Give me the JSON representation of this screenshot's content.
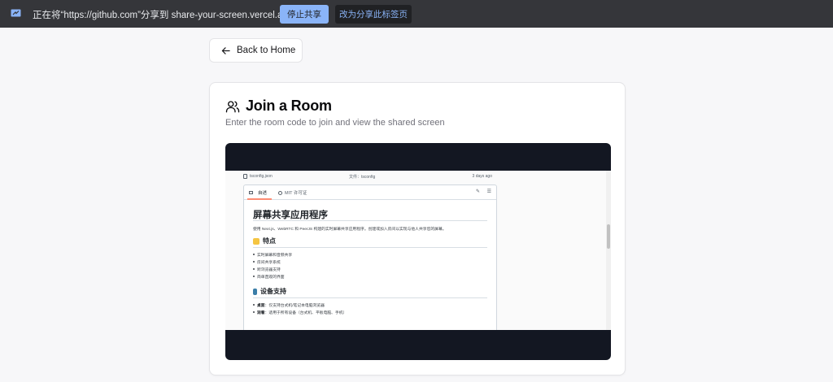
{
  "share_bar": {
    "message": "正在将“https://github.com”分享到 share-your-screen.vercel.app",
    "stop_label": "停止共享",
    "switch_label": "改为分享此标签页"
  },
  "back_button": {
    "label": "Back to Home",
    "icon": "arrow-left-icon"
  },
  "card": {
    "icon": "users-icon",
    "title": "Join a Room",
    "subtitle": "Enter the room code to join and view the shared screen"
  },
  "shared_screen": {
    "file_header": {
      "name": "tsconfig.json",
      "commit": "文件：tsconfig",
      "time": "3 days ago"
    },
    "tabs": {
      "readme": "自述",
      "license": "MIT 许可证"
    },
    "readme": {
      "title": "屏幕共享应用程序",
      "description": "使用 Next.js、WebRTC 和 PeerJS 构建的实时屏幕共享应用程序。创建或加入房间以实现与他人共享您的屏幕。",
      "features_heading": "特点",
      "features": [
        "实时屏幕和音频共享",
        "房间共享系统",
        "跨浏览器支持",
        "简单直观的界面"
      ],
      "devices_heading": "设备支持",
      "devices": [
        {
          "label": "桌面",
          "text": "：仅支持台式机/笔记本电脑浏览器"
        },
        {
          "label": "观看",
          "text": "：适用于所有设备（台式机、平板电脑、手机）"
        }
      ]
    }
  },
  "colors": {
    "share_bar_bg": "#35363a",
    "stop_button": "#8ab4f8",
    "video_bg": "#131722",
    "tab_accent": "#fd8c73"
  }
}
